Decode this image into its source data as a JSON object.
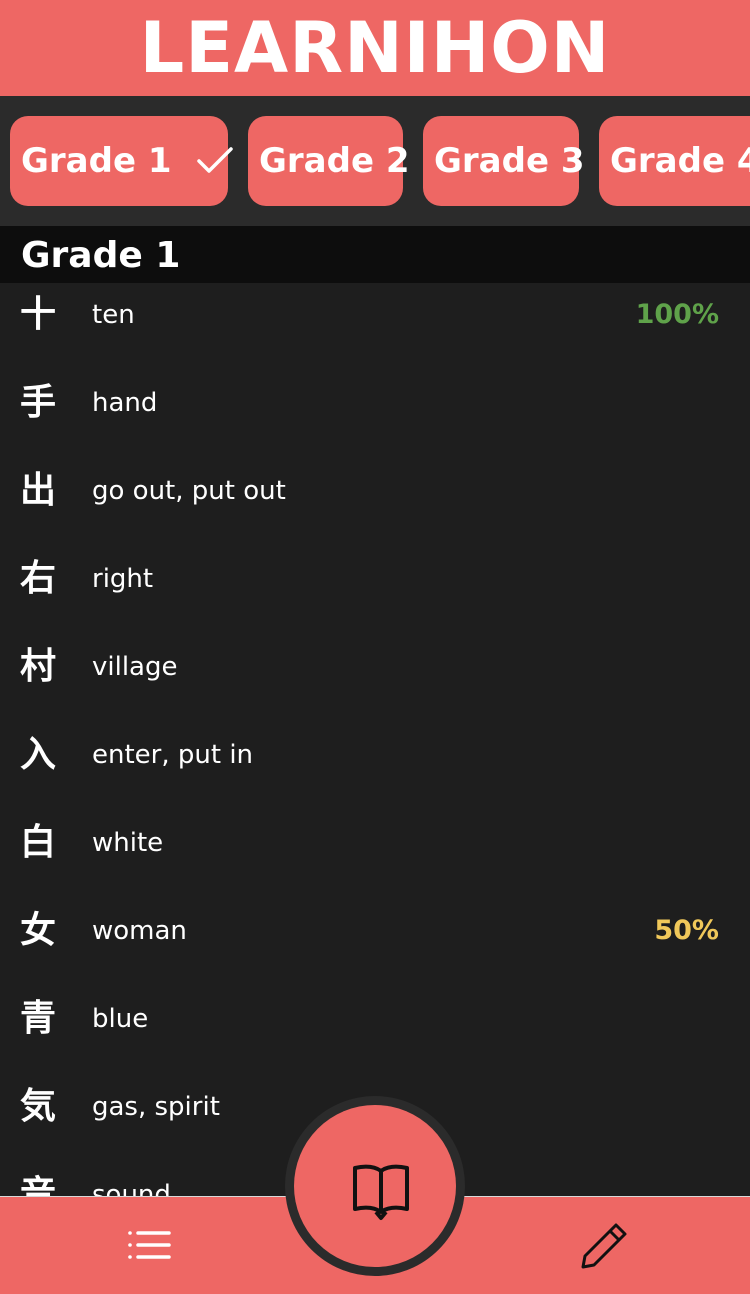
{
  "app": {
    "title": "LEARNIHON",
    "accent_color": "#ee6764",
    "background_color": "#1e1e1e"
  },
  "grades": [
    {
      "label": "Grade 1",
      "selected": true
    },
    {
      "label": "Grade 2",
      "selected": false
    },
    {
      "label": "Grade 3",
      "selected": false
    },
    {
      "label": "Grade 4",
      "selected": false
    }
  ],
  "section": {
    "title": "Grade 1"
  },
  "kanji": [
    {
      "char": "十",
      "meaning": "ten",
      "score": "100%",
      "score_color": "#5fa24a"
    },
    {
      "char": "手",
      "meaning": "hand",
      "score": "",
      "score_color": ""
    },
    {
      "char": "出",
      "meaning": "go out, put out",
      "score": "",
      "score_color": ""
    },
    {
      "char": "右",
      "meaning": "right",
      "score": "",
      "score_color": ""
    },
    {
      "char": "村",
      "meaning": "village",
      "score": "",
      "score_color": ""
    },
    {
      "char": "入",
      "meaning": "enter, put in",
      "score": "",
      "score_color": ""
    },
    {
      "char": "白",
      "meaning": "white",
      "score": "",
      "score_color": ""
    },
    {
      "char": "女",
      "meaning": "woman",
      "score": "50%",
      "score_color": "#f0c85a"
    },
    {
      "char": "青",
      "meaning": "blue",
      "score": "",
      "score_color": ""
    },
    {
      "char": "気",
      "meaning": "gas, spirit",
      "score": "",
      "score_color": ""
    },
    {
      "char": "音",
      "meaning": "sound",
      "score": "",
      "score_color": ""
    }
  ],
  "bottom_nav": {
    "left_icon": "list-icon",
    "center_icon": "open-book-icon",
    "right_icon": "pencil-icon"
  }
}
